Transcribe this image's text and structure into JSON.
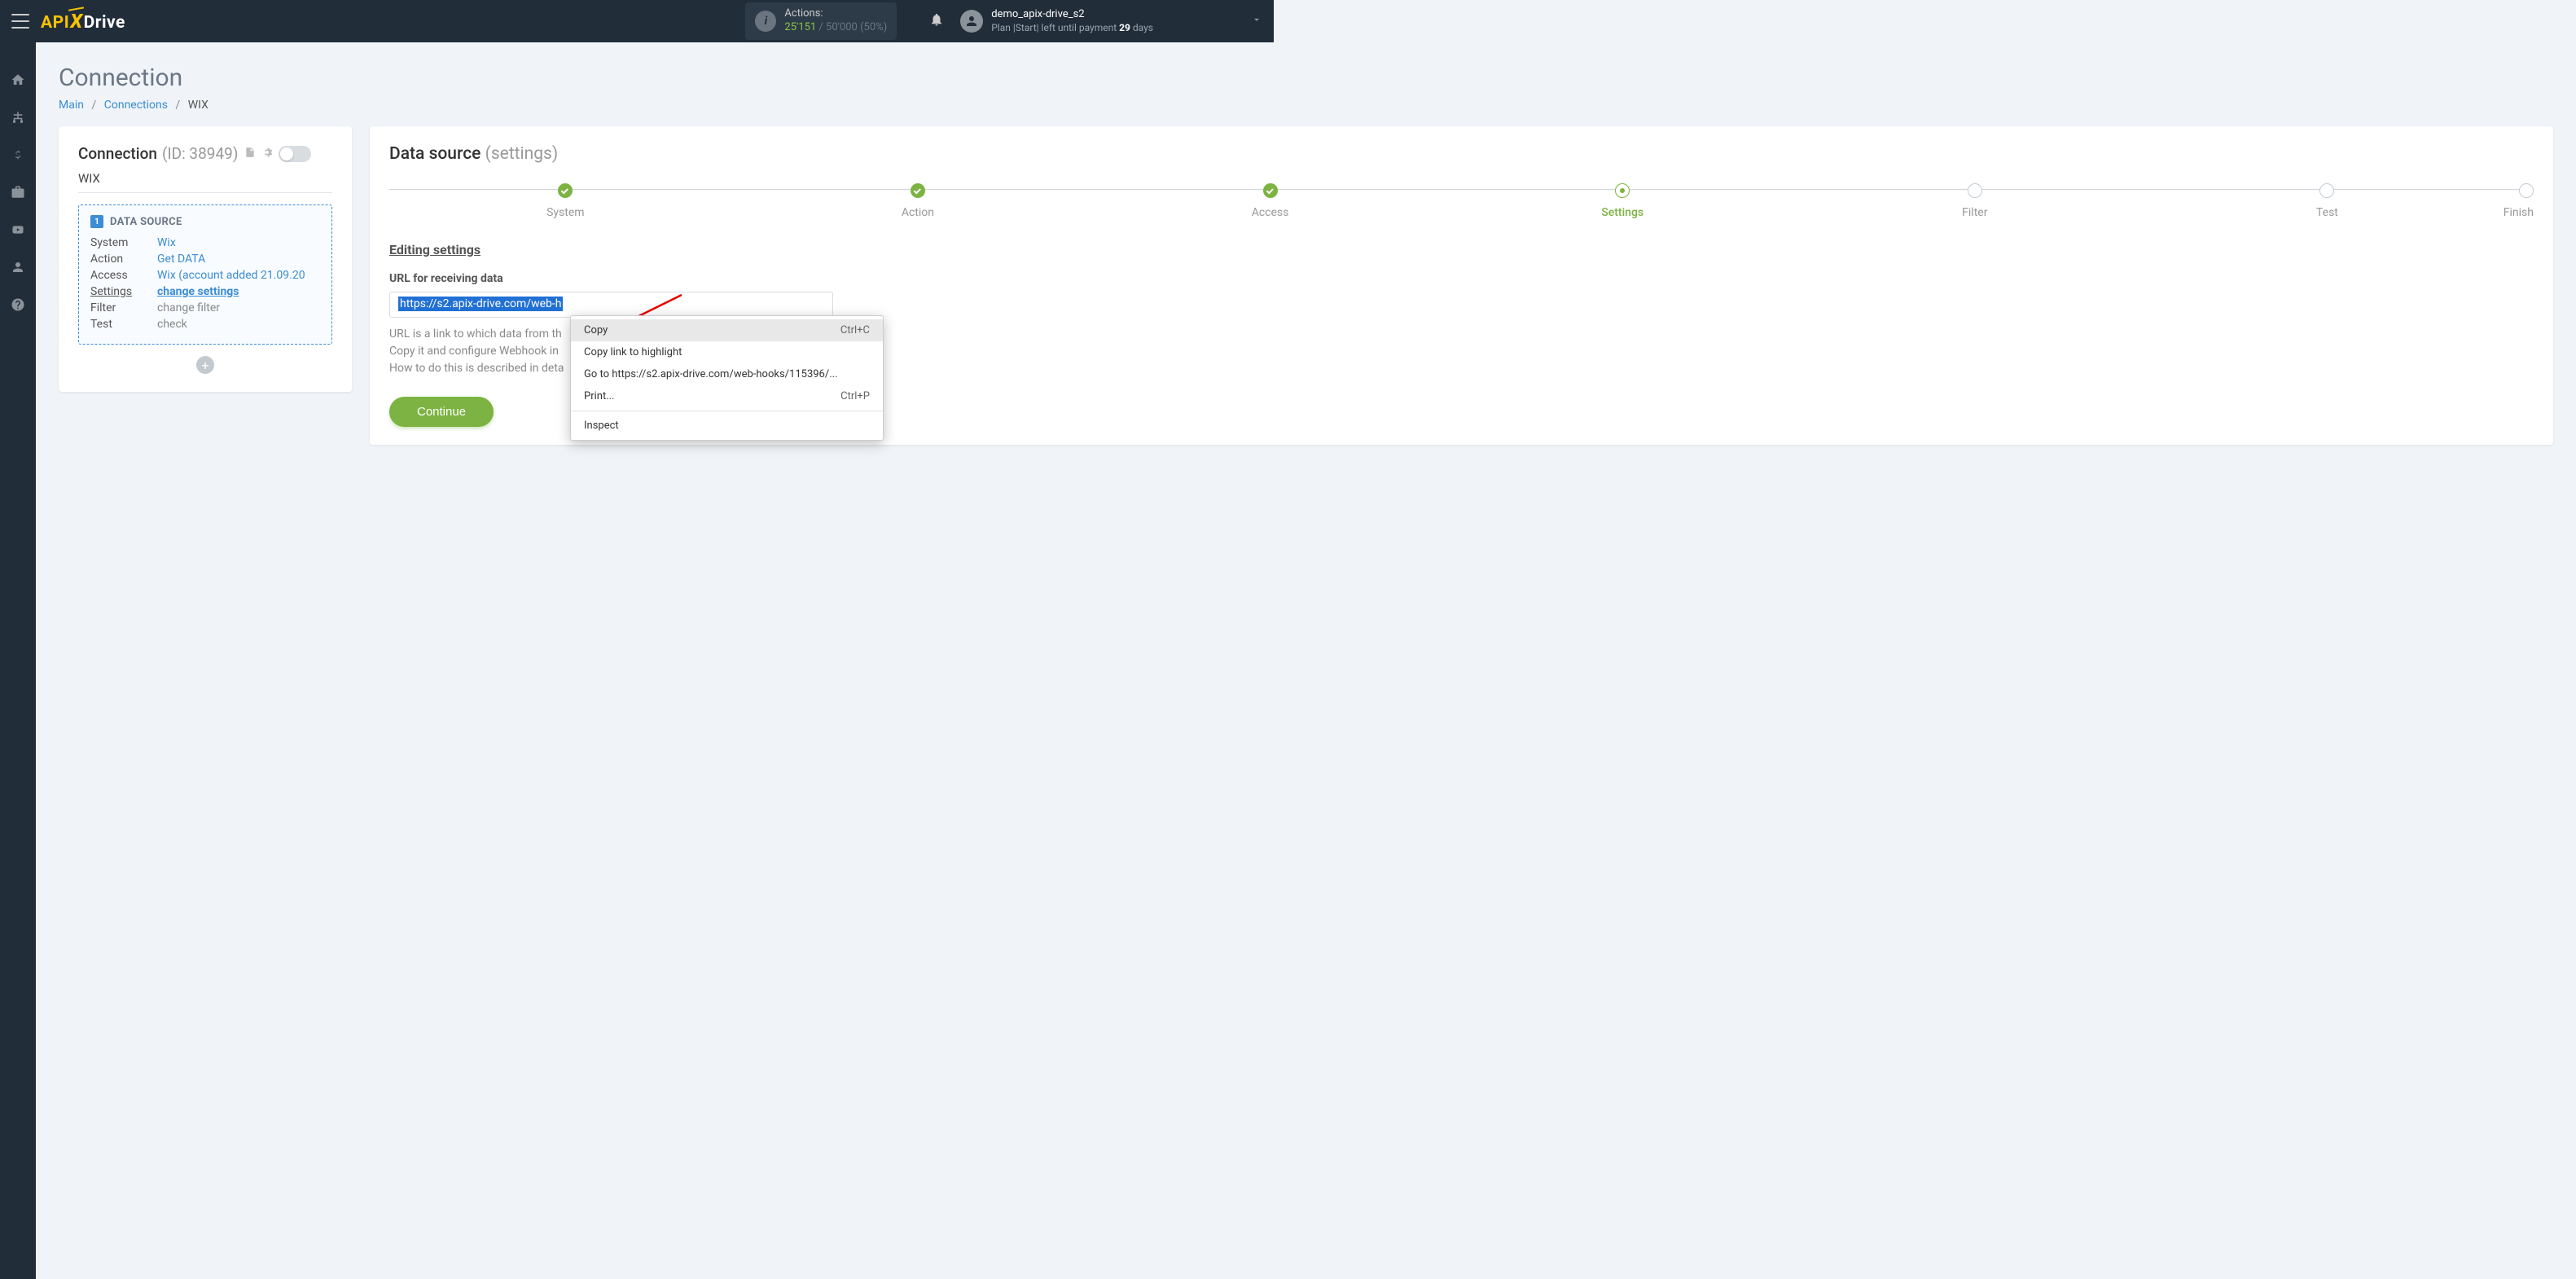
{
  "topbar": {
    "logo": {
      "api": "API",
      "x": "X",
      "drive": "Drive"
    },
    "actions": {
      "label": "Actions:",
      "used": "25'151",
      "limit": "/ 50'000",
      "pct": "(50%)"
    },
    "user": {
      "name": "demo_apix-drive_s2",
      "plan_prefix": "Plan |Start| left until payment ",
      "days": "29",
      "days_suffix": " days"
    }
  },
  "page": {
    "title": "Connection"
  },
  "breadcrumb": {
    "main": "Main",
    "connections": "Connections",
    "current": "WIX"
  },
  "left": {
    "title": "Connection",
    "id": "(ID: 38949)",
    "name": "WIX",
    "ds_num": "1",
    "ds_title": "DATA SOURCE",
    "rows": {
      "system_k": "System",
      "system_v": "Wix",
      "action_k": "Action",
      "action_v": "Get DATA",
      "access_k": "Access",
      "access_v": "Wix (account added 21.09.20",
      "settings_k": "Settings",
      "settings_v": "change settings",
      "filter_k": "Filter",
      "filter_v": "change filter",
      "test_k": "Test",
      "test_v": "check"
    },
    "add": "+"
  },
  "right": {
    "title": "Data source",
    "sub": "(settings)",
    "steps": [
      {
        "label": "System",
        "state": "done"
      },
      {
        "label": "Action",
        "state": "done"
      },
      {
        "label": "Access",
        "state": "done"
      },
      {
        "label": "Settings",
        "state": "current"
      },
      {
        "label": "Filter",
        "state": "todo"
      },
      {
        "label": "Test",
        "state": "todo"
      },
      {
        "label": "Finish",
        "state": "todo"
      }
    ],
    "heading": "Editing settings",
    "field_label": "URL for receiving data",
    "url_visible": "https://s2.apix-drive.com/web-h",
    "help1": "URL is a link to which data from th",
    "help2": "Copy it and configure Webhook in",
    "help3": "How to do this is described in deta",
    "continue": "Continue"
  },
  "context": {
    "copy": "Copy",
    "copy_sc": "Ctrl+C",
    "copy_link": "Copy link to highlight",
    "goto": "Go to https://s2.apix-drive.com/web-hooks/115396/...",
    "print": "Print...",
    "print_sc": "Ctrl+P",
    "inspect": "Inspect"
  }
}
